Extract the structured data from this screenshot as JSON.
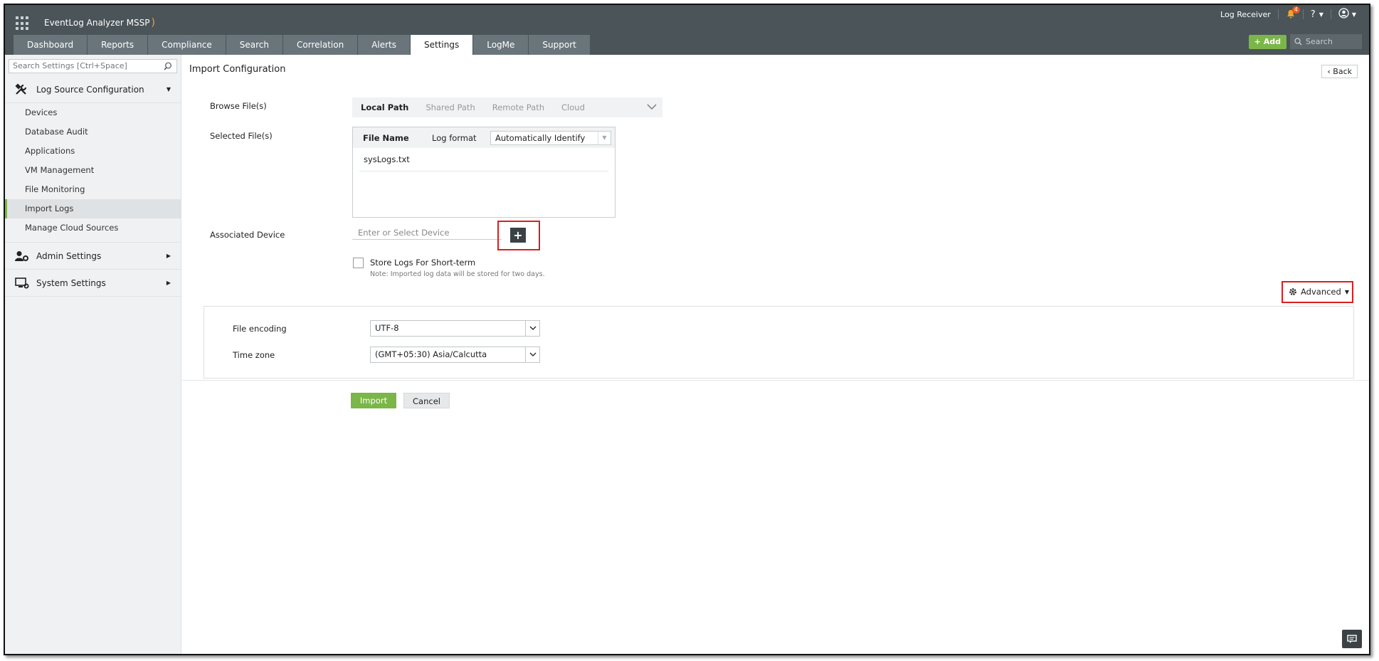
{
  "app": {
    "name": "EventLog Analyzer MSSP"
  },
  "header": {
    "log_receiver": "Log Receiver",
    "notification_count": "4",
    "help": "?",
    "add_label": "Add",
    "search_placeholder": "Search"
  },
  "tabs": [
    {
      "label": "Dashboard"
    },
    {
      "label": "Reports"
    },
    {
      "label": "Compliance"
    },
    {
      "label": "Search"
    },
    {
      "label": "Correlation"
    },
    {
      "label": "Alerts"
    },
    {
      "label": "Settings",
      "active": true
    },
    {
      "label": "LogMe"
    },
    {
      "label": "Support"
    }
  ],
  "sidebar": {
    "search_placeholder": "Search Settings [Ctrl+Space]",
    "sections": [
      {
        "label": "Log Source Configuration",
        "icon": "tools-icon",
        "expanded": true
      },
      {
        "label": "Admin Settings",
        "icon": "admin-settings-icon",
        "expanded": false
      },
      {
        "label": "System Settings",
        "icon": "system-settings-icon",
        "expanded": false
      }
    ],
    "items": [
      {
        "label": "Devices"
      },
      {
        "label": "Database Audit"
      },
      {
        "label": "Applications"
      },
      {
        "label": "VM Management"
      },
      {
        "label": "File Monitoring"
      },
      {
        "label": "Import Logs",
        "active": true
      },
      {
        "label": "Manage Cloud Sources"
      }
    ]
  },
  "main": {
    "title": "Import Configuration",
    "back_label": "Back",
    "browse_label": "Browse File(s)",
    "path_tabs": [
      {
        "label": "Local Path",
        "active": true
      },
      {
        "label": "Shared Path"
      },
      {
        "label": "Remote Path"
      },
      {
        "label": "Cloud"
      }
    ],
    "selected_label": "Selected File(s)",
    "file_table": {
      "col_file_name": "File Name",
      "col_log_format": "Log format",
      "log_format_value": "Automatically Identify",
      "files": [
        "sysLogs.txt"
      ]
    },
    "associated_device_label": "Associated Device",
    "device_placeholder": "Enter or Select Device",
    "store_logs_label": "Store Logs For Short-term",
    "store_logs_checked": false,
    "note": "Note: Imported log data will be stored for two days.",
    "advanced_label": "Advanced",
    "file_encoding_label": "File encoding",
    "file_encoding_value": "UTF-8",
    "time_zone_label": "Time zone",
    "time_zone_value": "(GMT+05:30) Asia/Calcutta",
    "import_label": "Import",
    "cancel_label": "Cancel"
  },
  "colors": {
    "header_bg": "#4a5459",
    "accent_green": "#7ab648",
    "highlight_red": "#d9201e"
  }
}
